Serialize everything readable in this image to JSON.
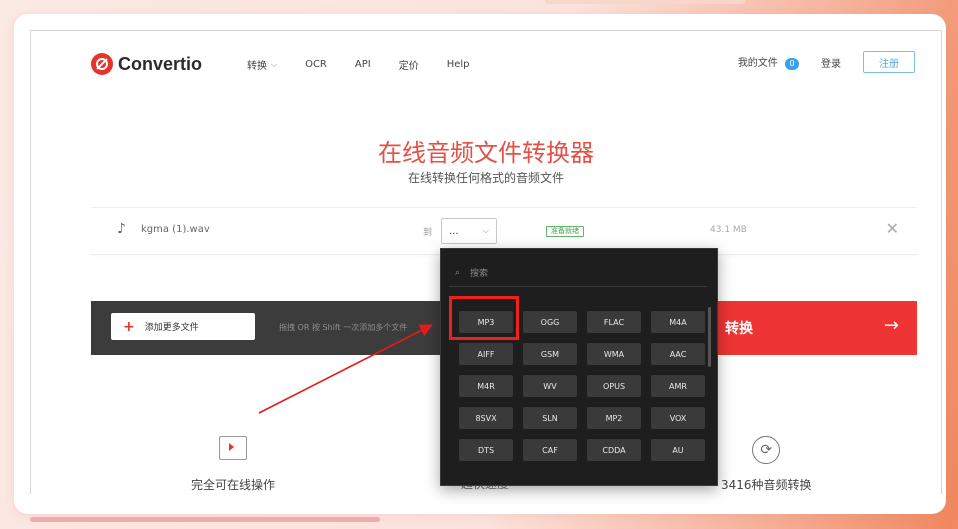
{
  "header": {
    "brand": "Convertio",
    "nav": [
      {
        "label": "转换",
        "has_menu": true
      },
      {
        "label": "OCR"
      },
      {
        "label": "API"
      },
      {
        "label": "定价"
      },
      {
        "label": "Help"
      }
    ],
    "my_files_label": "我的文件",
    "my_files_count": "0",
    "login_label": "登录",
    "signup_label": "注册"
  },
  "hero": {
    "title": "在线音频文件转换器",
    "subtitle": "在线转换任何格式的音频文件"
  },
  "file_row": {
    "icon": "music-note-icon",
    "file_name": "kgma (1).wav",
    "to_label": "到",
    "selected_format": "...",
    "status_badge": "准备就绪",
    "file_size": "43.1 MB",
    "status_color": "#4aa056"
  },
  "action_bar": {
    "add_files_label": "添加更多文件",
    "hint_text": "拖拽 OR 按 Shift 一次添加多个文件",
    "convert_label": "转换",
    "convert_color": "#ee3434"
  },
  "dropdown": {
    "search_placeholder": "搜索",
    "formats": [
      "MP3",
      "OGG",
      "FLAC",
      "M4A",
      "AIFF",
      "GSM",
      "WMA",
      "AAC",
      "M4R",
      "WV",
      "OPUS",
      "AMR",
      "8SVX",
      "SLN",
      "MP2",
      "VOX",
      "DTS",
      "CAF",
      "CDDA",
      "AU"
    ],
    "highlighted_format": "MP3",
    "highlight_color": "#f11f1f"
  },
  "features": [
    {
      "label": "完全可在线操作",
      "icon": "cursor-window-icon"
    },
    {
      "label": "超快速度",
      "icon": "speed-icon"
    },
    {
      "label": "3416种音频转换",
      "icon": "refresh-icon"
    }
  ]
}
